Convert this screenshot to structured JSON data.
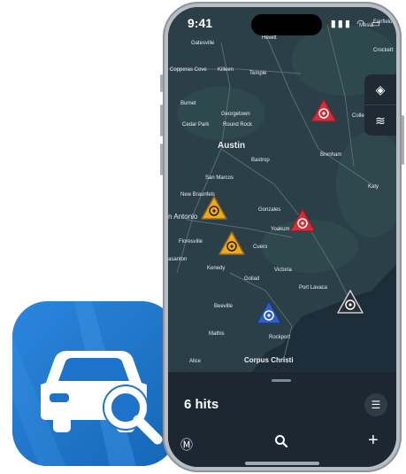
{
  "status_bar": {
    "time": "9:41",
    "icons": "▮▮▮ ◠ ▭"
  },
  "map": {
    "labels": {
      "mesia": "Mesia",
      "fairfield": "Fairfield",
      "crockett": "Crockett",
      "gatesville": "Gatesville",
      "hewitt": "Hewitt",
      "copperas_cove": "Copperas Cove",
      "killeen": "Killeen",
      "temple": "Temple",
      "burnet": "Burnet",
      "georgetown": "Georgetown",
      "cedar_park": "Cedar Park",
      "round_rock": "Round Rock",
      "college_station": "College S",
      "austin": "Austin",
      "bastrop": "Bastrop",
      "brenham": "Brenham",
      "san_marcos": "San Marcos",
      "new_braunfels": "New Braunfels",
      "gonzales": "Gonzales",
      "katy": "Katy",
      "san_antonio": "n Antonio",
      "yoakum": "Yoakum",
      "floresville": "Floresville",
      "cuero": "Cuero",
      "pleasanton": "asanton",
      "kenedy": "Kenedy",
      "victoria": "Victoria",
      "goliad": "Goliad",
      "port_lavaca": "Port Lavaca",
      "beeville": "Beeville",
      "rockport": "Rockport",
      "mathis": "Mathis",
      "alice": "Alice",
      "corpus_christi": "Corpus Christi"
    },
    "controls": {
      "locate_icon": "locate-icon",
      "layers_icon": "layers-icon"
    },
    "markers": [
      {
        "color": "#d32f3a",
        "label": "marker-red-1"
      },
      {
        "color": "#f2a81d",
        "label": "marker-yellow-1"
      },
      {
        "color": "#d32f3a",
        "label": "marker-red-2"
      },
      {
        "color": "#f2a81d",
        "label": "marker-yellow-2"
      },
      {
        "color": "#2f5fc4",
        "label": "marker-blue"
      },
      {
        "color": "#2a2e33",
        "label": "marker-dark"
      }
    ]
  },
  "sheet": {
    "hits": "6 hits",
    "filter_icon": "filter-icon"
  },
  "tabbar": {
    "m_icon": "Ⓜ",
    "search_icon": "search-icon",
    "add_icon": "+"
  },
  "app_icon": {
    "name": "car-search-app-icon"
  },
  "colors": {
    "accent": "#1d73c9",
    "map_bg": "#263a45",
    "sheet_bg": "#1c2731"
  }
}
